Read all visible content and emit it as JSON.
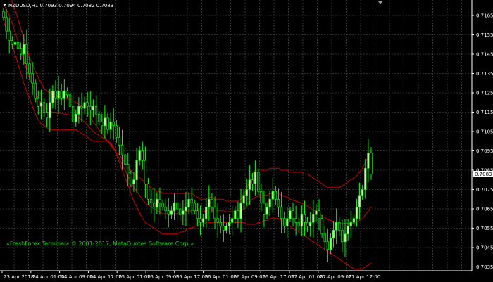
{
  "chart": {
    "symbol_label": "NZDUSD,H1  0.7093 0.7094 0.7082 0.7083",
    "copyright": "«FreshForex Terminal» © 2001-2017, MetaQuotes Software Corp.»",
    "current_price_label": "0.7083",
    "current_price": 0.7083,
    "price_labels": [
      "0.7165",
      "0.7155",
      "0.7145",
      "0.7135",
      "0.7125",
      "0.7115",
      "0.7105",
      "0.7095",
      "0.7085",
      "0.7075",
      "0.7065",
      "0.7055",
      "0.7045",
      "0.7035"
    ],
    "time_labels": [
      "23 Apr 2018",
      "24 Apr 01:00",
      "24 Apr 09:00",
      "24 Apr 17:00",
      "25 Apr 01:00",
      "25 Apr 09:00",
      "25 Apr 17:00",
      "26 Apr 01:00",
      "26 Apr 09:00",
      "26 Apr 17:00",
      "27 Apr 01:00",
      "27 Apr 09:00",
      "27 Apr 17:00"
    ],
    "colors": {
      "background": "#000000",
      "grid": "#5a5a5a",
      "axis": "#ffffff",
      "bull_candle": "#c8f5a0",
      "bear_candle": "#000000",
      "candle_outline": "#00ff00",
      "bands": "#cc0000",
      "text": "#ffffff",
      "copyright": "#00e000"
    }
  },
  "chart_data": {
    "type": "candlestick",
    "price_range": [
      0.7033,
      0.7173
    ],
    "bars_count": 128,
    "close_series": [
      0.7164,
      0.7157,
      0.7152,
      0.715,
      0.7151,
      0.7148,
      0.7145,
      0.715,
      0.714,
      0.7135,
      0.713,
      0.7122,
      0.7118,
      0.712,
      0.7115,
      0.7112,
      0.712,
      0.7126,
      0.7122,
      0.7126,
      0.7122,
      0.7126,
      0.7124,
      0.7118,
      0.711,
      0.7114,
      0.7118,
      0.7117,
      0.712,
      0.7118,
      0.7116,
      0.7118,
      0.7114,
      0.711,
      0.7108,
      0.7112,
      0.7106,
      0.711,
      0.7108,
      0.7102,
      0.7098,
      0.7093,
      0.7088,
      0.7083,
      0.7078,
      0.708,
      0.709,
      0.7095,
      0.709,
      0.7078,
      0.707,
      0.7068,
      0.7066,
      0.707,
      0.7068,
      0.7066,
      0.7064,
      0.7062,
      0.7064,
      0.7068,
      0.7065,
      0.7062,
      0.7064,
      0.7066,
      0.707,
      0.7068,
      0.7064,
      0.706,
      0.7058,
      0.706,
      0.7066,
      0.707,
      0.7066,
      0.706,
      0.7058,
      0.7056,
      0.7054,
      0.7056,
      0.7058,
      0.706,
      0.7064,
      0.706,
      0.7068,
      0.7072,
      0.7075,
      0.708,
      0.7078,
      0.7084,
      0.7074,
      0.7068,
      0.7062,
      0.7066,
      0.707,
      0.7074,
      0.707,
      0.7066,
      0.706,
      0.7056,
      0.706,
      0.7064,
      0.706,
      0.7058,
      0.7056,
      0.7062,
      0.7058,
      0.7056,
      0.7058,
      0.7062,
      0.7064,
      0.706,
      0.7052,
      0.7048,
      0.7044,
      0.705,
      0.7054,
      0.7058,
      0.7054,
      0.7048,
      0.7052,
      0.7056,
      0.7058,
      0.706,
      0.7066,
      0.7072,
      0.7075,
      0.7086,
      0.7094,
      0.7083
    ],
    "upper_band": [
      0.718,
      0.7178,
      0.7175,
      0.7172,
      0.7168,
      0.7163,
      0.7158,
      0.7153,
      0.7148,
      0.7143,
      0.714,
      0.7136,
      0.7133,
      0.713,
      0.7127,
      0.7126,
      0.7125,
      0.7124,
      0.7124,
      0.7123,
      0.7123,
      0.7122,
      0.7122,
      0.7121,
      0.7121,
      0.712,
      0.7119,
      0.7118,
      0.7117,
      0.7115,
      0.7112,
      0.711,
      0.7108,
      0.7106,
      0.7104,
      0.7102,
      0.71,
      0.7098,
      0.7096,
      0.7094,
      0.7093,
      0.7091,
      0.7089,
      0.7087,
      0.7085,
      0.7083,
      0.7082,
      0.7081,
      0.708,
      0.7078,
      0.7077,
      0.7076,
      0.7075,
      0.7074,
      0.7074,
      0.7073,
      0.7073,
      0.7073,
      0.7073,
      0.7073,
      0.7073,
      0.7073,
      0.7073,
      0.7073,
      0.7073,
      0.7073,
      0.7072,
      0.7071,
      0.707,
      0.707,
      0.707,
      0.7071,
      0.7071,
      0.707,
      0.707,
      0.707,
      0.707,
      0.7069,
      0.7069,
      0.7069,
      0.7069,
      0.7069,
      0.707,
      0.7072,
      0.7075,
      0.708,
      0.7083,
      0.7085,
      0.7085,
      0.7085,
      0.7085,
      0.7085,
      0.7086,
      0.7086,
      0.7086,
      0.7086,
      0.7085,
      0.7085,
      0.7085,
      0.7084,
      0.7084,
      0.7084,
      0.7084,
      0.7084,
      0.7083,
      0.7083,
      0.7082,
      0.7081,
      0.708,
      0.7079,
      0.7078,
      0.7077,
      0.7076,
      0.7076,
      0.7076,
      0.7076,
      0.7076,
      0.7077,
      0.7078,
      0.7079,
      0.708,
      0.7081,
      0.7082,
      0.7084,
      0.7086,
      0.7089,
      0.7092,
      0.7095
    ],
    "lower_band": [
      0.7162,
      0.7158,
      0.7155,
      0.715,
      0.7145,
      0.714,
      0.7135,
      0.713,
      0.7126,
      0.7122,
      0.7118,
      0.7114,
      0.7111,
      0.7109,
      0.7108,
      0.7107,
      0.7106,
      0.7106,
      0.7106,
      0.7106,
      0.7106,
      0.7106,
      0.7106,
      0.7106,
      0.7106,
      0.7106,
      0.7105,
      0.7104,
      0.7103,
      0.7102,
      0.7101,
      0.71,
      0.71,
      0.71,
      0.71,
      0.71,
      0.71,
      0.7099,
      0.7097,
      0.7093,
      0.7089,
      0.7085,
      0.7081,
      0.7077,
      0.7073,
      0.7069,
      0.7066,
      0.7063,
      0.706,
      0.7058,
      0.7057,
      0.7056,
      0.7055,
      0.7054,
      0.7053,
      0.7052,
      0.7052,
      0.7052,
      0.7052,
      0.7052,
      0.7052,
      0.7053,
      0.7053,
      0.7054,
      0.7055,
      0.7055,
      0.7056,
      0.7056,
      0.7057,
      0.7057,
      0.7058,
      0.7058,
      0.7058,
      0.7058,
      0.7058,
      0.7058,
      0.7058,
      0.7058,
      0.7058,
      0.7058,
      0.7058,
      0.7058,
      0.7058,
      0.7058,
      0.7057,
      0.7057,
      0.7057,
      0.7057,
      0.7058,
      0.7058,
      0.7059,
      0.7059,
      0.706,
      0.706,
      0.706,
      0.706,
      0.7059,
      0.7058,
      0.7057,
      0.7056,
      0.7055,
      0.7054,
      0.7053,
      0.7052,
      0.7051,
      0.705,
      0.7049,
      0.7048,
      0.7047,
      0.7046,
      0.7045,
      0.7044,
      0.7043,
      0.7042,
      0.7041,
      0.704,
      0.7039,
      0.7038,
      0.7037,
      0.7036,
      0.7035,
      0.7034,
      0.7034,
      0.7034,
      0.7034,
      0.7035,
      0.7036,
      0.7037
    ]
  }
}
